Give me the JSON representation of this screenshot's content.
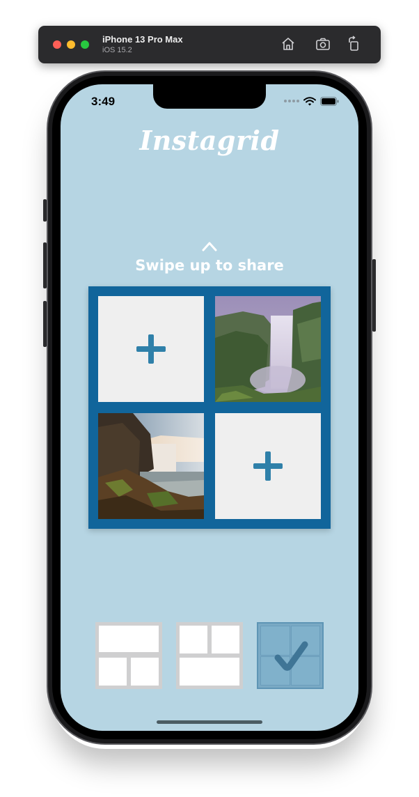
{
  "simulator": {
    "device_name": "iPhone 13 Pro Max",
    "os_version": "iOS 15.2",
    "icons": [
      "home-icon",
      "screenshot-icon",
      "rotate-icon"
    ]
  },
  "status_bar": {
    "time": "3:49",
    "icons": [
      "cellular-dots-icon",
      "wifi-icon",
      "battery-icon"
    ]
  },
  "app": {
    "title": "Instagrid",
    "swipe_hint": "Swipe up to share",
    "swipe_icon": "chevron-up-icon",
    "colors": {
      "background": "#b6d5e3",
      "grid_frame": "#11659b",
      "plus": "#2f80a9",
      "selected_layout": "#7aa9c4"
    }
  },
  "grid": {
    "cells": [
      {
        "state": "empty",
        "icon": "plus-icon"
      },
      {
        "state": "photo",
        "content": "waterfall in mist"
      },
      {
        "state": "photo",
        "content": "waterfall at sunset"
      },
      {
        "state": "empty",
        "icon": "plus-icon"
      }
    ]
  },
  "layouts": [
    {
      "name": "one-top-two-bottom",
      "selected": false
    },
    {
      "name": "two-top-one-bottom",
      "selected": false
    },
    {
      "name": "two-by-two",
      "selected": true,
      "icon": "checkmark-icon"
    }
  ]
}
